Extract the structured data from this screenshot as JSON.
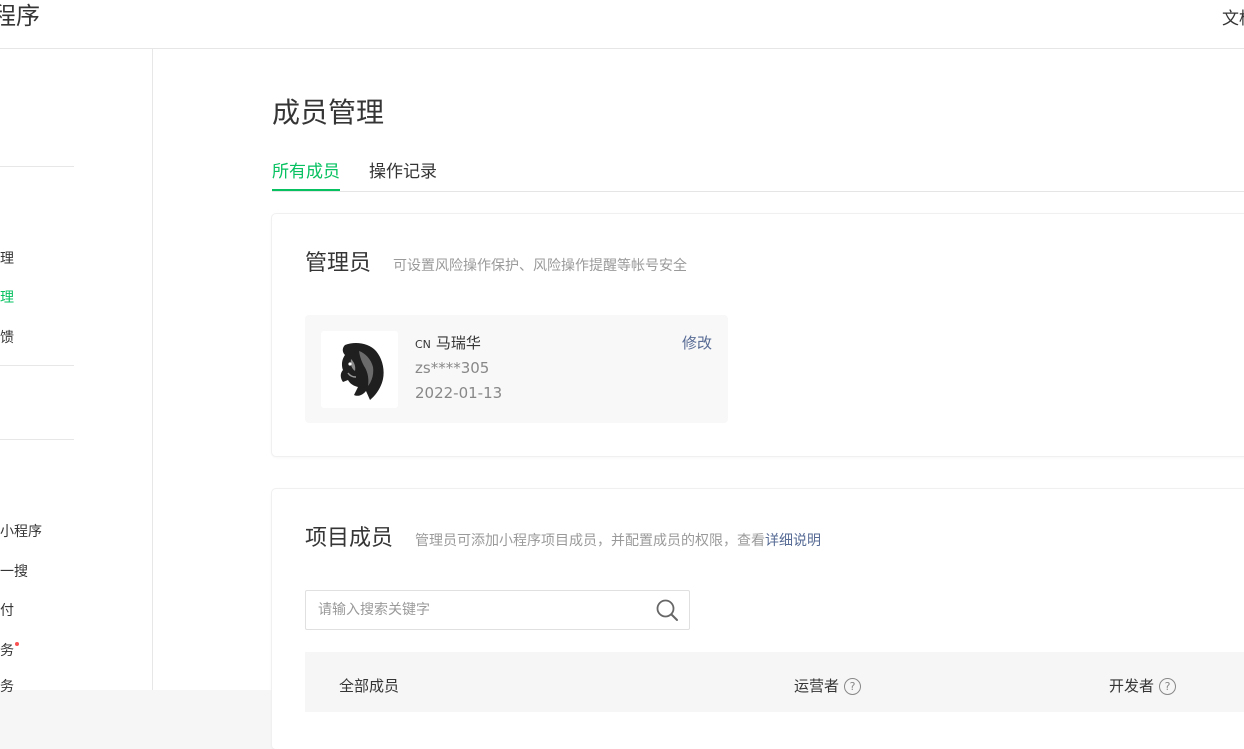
{
  "app": {
    "brand": "程序",
    "top_right": "文档"
  },
  "sidebar": {
    "items": [
      {
        "label": "理",
        "active": false
      },
      {
        "label": "理",
        "active": true
      },
      {
        "label": "馈",
        "active": false
      },
      {
        "label": "小程序",
        "active": false
      },
      {
        "label": "一搜",
        "active": false
      },
      {
        "label": "付",
        "active": false
      },
      {
        "label": "务",
        "active": false
      },
      {
        "label": "务",
        "active": false
      }
    ]
  },
  "page": {
    "title": "成员管理",
    "tabs": [
      {
        "label": "所有成员",
        "active": true
      },
      {
        "label": "操作记录",
        "active": false
      }
    ]
  },
  "admin_card": {
    "title": "管理员",
    "desc": "可设置风险操作保护、风险操作提醒等帐号安全",
    "admin": {
      "region": "CN",
      "name": "马瑞华",
      "id": "zs****305",
      "date": "2022-01-13",
      "edit_label": "修改"
    }
  },
  "members_card": {
    "title": "项目成员",
    "desc_prefix": "管理员可添加小程序项目成员，并配置成员的权限，查看",
    "desc_link": "详细说明",
    "search_placeholder": "请输入搜索关键字",
    "columns": [
      {
        "label": "全部成员"
      },
      {
        "label": "运营者"
      },
      {
        "label": "开发者"
      }
    ],
    "help_glyph": "?"
  },
  "colors": {
    "accent": "#07c160",
    "link": "#576b95",
    "notify_dot": "#fa5151"
  }
}
